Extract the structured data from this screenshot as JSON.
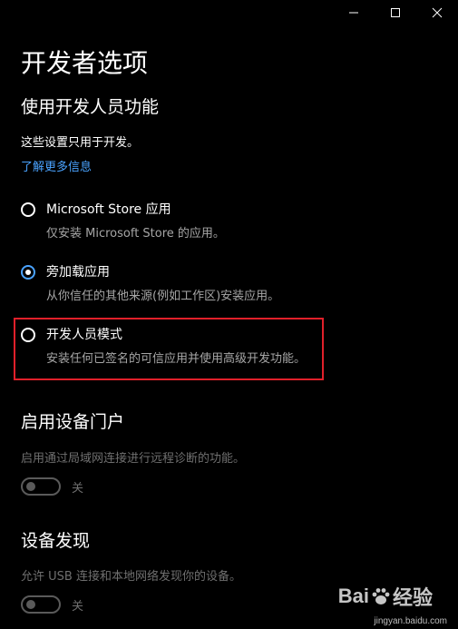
{
  "window": {
    "controls": [
      "minimize",
      "maximize",
      "close"
    ]
  },
  "page": {
    "title": "开发者选项"
  },
  "dev_features": {
    "heading": "使用开发人员功能",
    "description": "这些设置只用于开发。",
    "learn_more": "了解更多信息",
    "options": [
      {
        "label": "Microsoft Store 应用",
        "subtext": "仅安装 Microsoft Store 的应用。",
        "selected": false
      },
      {
        "label": "旁加载应用",
        "subtext": "从你信任的其他来源(例如工作区)安装应用。",
        "selected": true
      },
      {
        "label": "开发人员模式",
        "subtext": "安装任何已签名的可信应用并使用高级开发功能。",
        "selected": false
      }
    ]
  },
  "device_portal": {
    "heading": "启用设备门户",
    "description": "启用通过局域网连接进行远程诊断的功能。",
    "toggle_state": "关"
  },
  "device_discovery": {
    "heading": "设备发现",
    "description": "允许 USB 连接和本地网络发现你的设备。",
    "toggle_state": "关"
  },
  "watermark": {
    "brand": "Bai",
    "brand_suffix": "经验",
    "url": "jingyan.baidu.com"
  },
  "colors": {
    "background": "#000000",
    "accent": "#4aa3ff",
    "highlight": "#e0202a",
    "muted_text": "#a6a6a6",
    "disabled_text": "#6f6f6f"
  }
}
